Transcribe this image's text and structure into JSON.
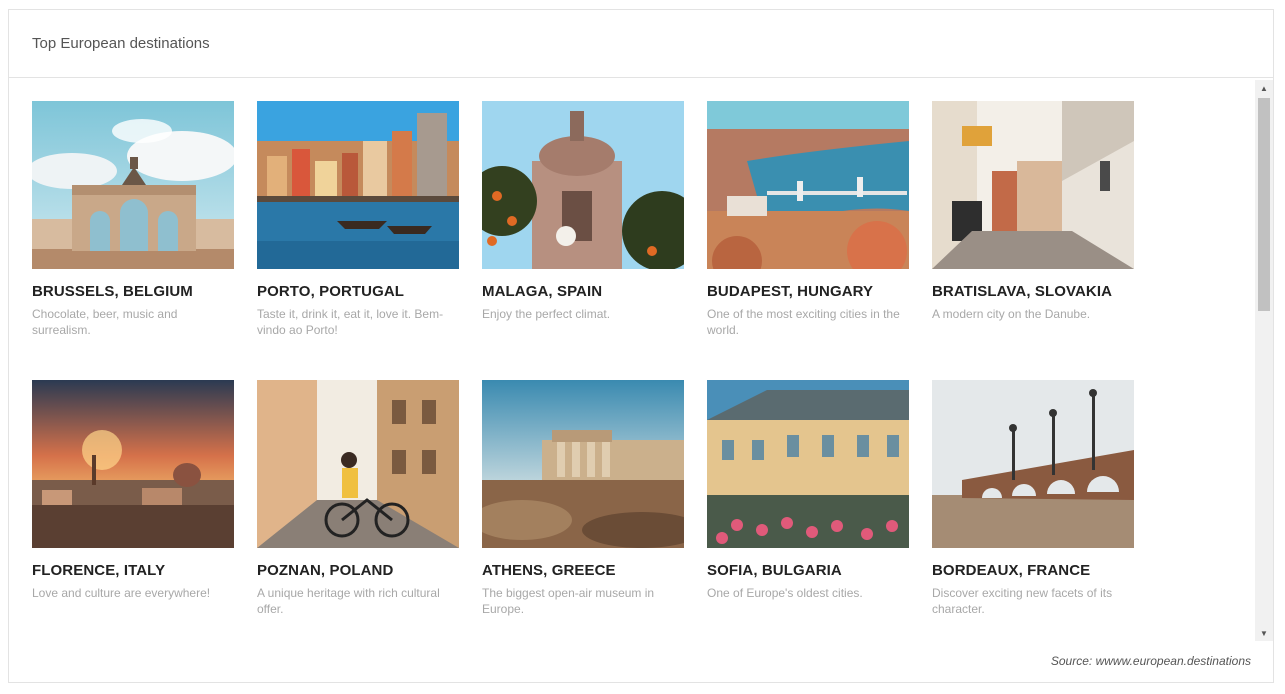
{
  "widget": {
    "title": "Top European destinations",
    "source": "Source: wwww.european.destinations"
  },
  "destinations": [
    {
      "title": "BRUSSELS, BELGIUM",
      "desc": "Chocolate, beer, music and surrealism."
    },
    {
      "title": "PORTO, PORTUGAL",
      "desc": "Taste it, drink it, eat it, love it. Bem-vindo ao Porto!"
    },
    {
      "title": "MALAGA, SPAIN",
      "desc": "Enjoy the perfect climat."
    },
    {
      "title": "BUDAPEST, HUNGARY",
      "desc": "One of the most exciting cities in the world."
    },
    {
      "title": "BRATISLAVA, SLOVAKIA",
      "desc": "A modern city on the Danube."
    },
    {
      "title": "FLORENCE, ITALY",
      "desc": "Love and culture are everywhere!"
    },
    {
      "title": "POZNAN, POLAND",
      "desc": "A unique heritage with rich cultural offer."
    },
    {
      "title": "ATHENS, GREECE",
      "desc": "The biggest open-air museum in Europe."
    },
    {
      "title": "SOFIA, BULGARIA",
      "desc": "One of Europe's oldest cities."
    },
    {
      "title": "BORDEAUX, FRANCE",
      "desc": "Discover exciting new facets of its character."
    }
  ],
  "icons": {
    "scroll_up": "triangle-up-icon",
    "scroll_down": "triangle-down-icon"
  }
}
